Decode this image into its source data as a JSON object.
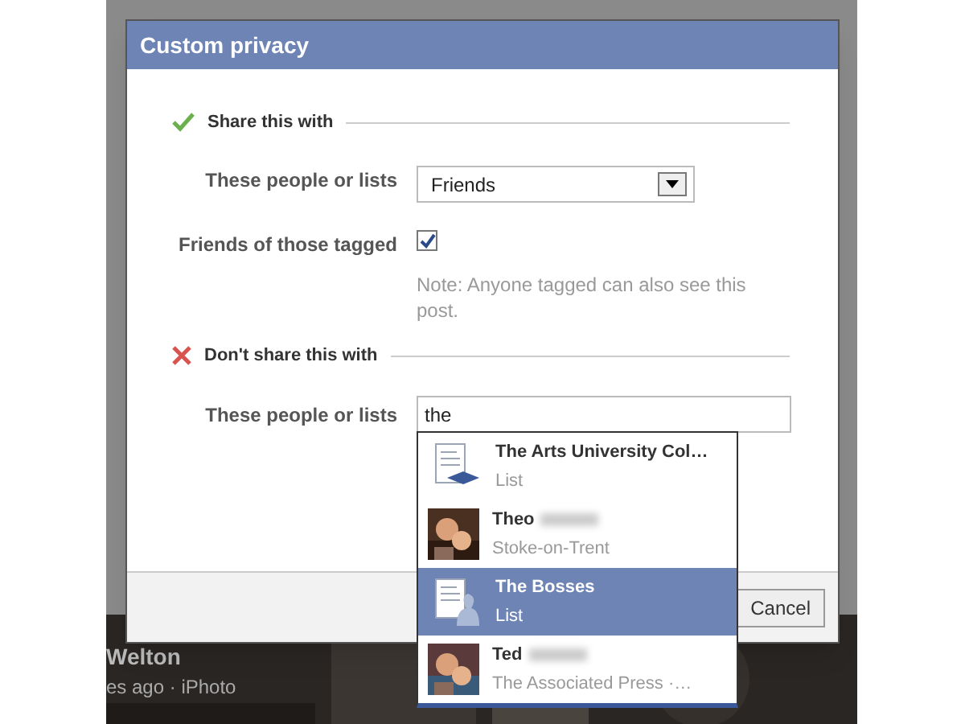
{
  "background": {
    "post_author": "Welton",
    "post_meta": "es ago · iPhoto"
  },
  "dialog": {
    "title": "Custom privacy",
    "share": {
      "heading": "Share this with",
      "audience_label": "These people or lists",
      "audience_value": "Friends",
      "tagged_label": "Friends of those tagged",
      "tagged_checked": true,
      "note": "Note: Anyone tagged can also see this post."
    },
    "exclude": {
      "heading": "Don't share this with",
      "audience_label": "These people or lists",
      "input_value": "the"
    },
    "suggestions": [
      {
        "kind": "list",
        "name": "The Arts University Col…",
        "detail": "List",
        "selected": false
      },
      {
        "kind": "person",
        "name": "Theo",
        "detail": "Stoke-on-Trent",
        "selected": false
      },
      {
        "kind": "list",
        "name": "The Bosses",
        "detail": "List",
        "selected": true
      },
      {
        "kind": "person",
        "name": "Ted",
        "detail": "The Associated Press ·…",
        "selected": false
      }
    ],
    "buttons": [
      "Cancel"
    ]
  }
}
